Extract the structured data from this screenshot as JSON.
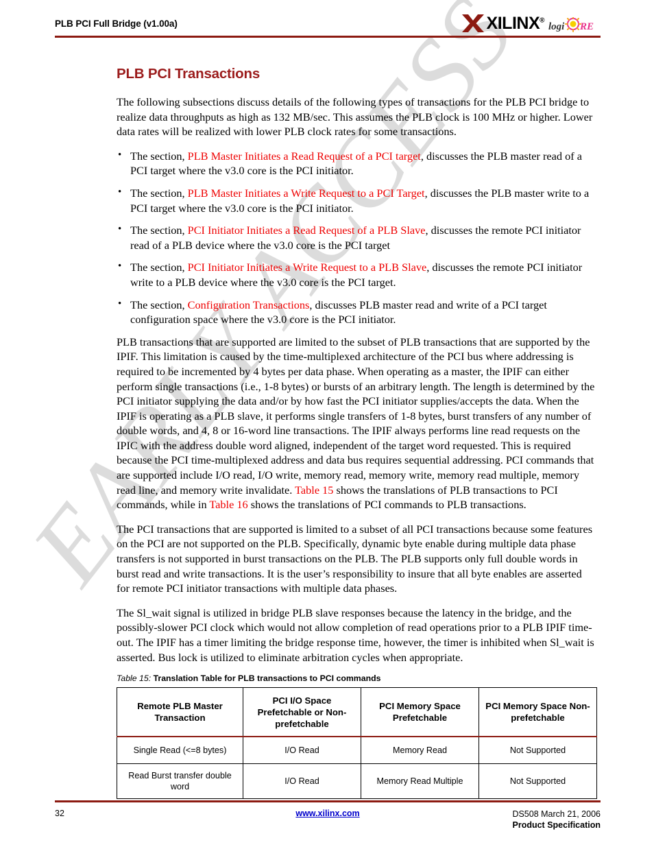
{
  "header": {
    "title": "PLB PCI Full Bridge (v1.00a)",
    "logo_wordmark": "XILINX",
    "logo_reg": "®",
    "logo_core": "logiCORE",
    "rule_color": "#8C1A11"
  },
  "watermark": {
    "text": "EARLY ACCESS",
    "color": "#dcdcdc"
  },
  "main": {
    "section_title": "PLB PCI Transactions",
    "title_color": "#9B1B1B",
    "xref_color": "#EE0000",
    "intro": "The following subsections discuss details of the following types of transactions for the PLB PCI bridge to realize data throughputs as high as 132 MB/sec. This assumes the PLB clock is 100 MHz or higher. Lower data rates will be realized with lower PLB clock rates for some transactions.",
    "bullets": [
      {
        "pre": "The section, ",
        "link": "PLB Master Initiates a Read Request of a PCI target",
        "post": ", discusses the PLB master read of a PCI target where the v3.0 core is the PCI initiator."
      },
      {
        "pre": "The section, ",
        "link": "PLB Master Initiates a Write Request to a PCI Target",
        "post": ", discusses the PLB master write to a PCI target where the v3.0 core is the PCI initiator."
      },
      {
        "pre": "The section, ",
        "link": "PCI Initiator Initiates a Read Request of a PLB Slave",
        "post": ", discusses the remote PCI initiator read of a PLB device where the v3.0 core is the PCI target"
      },
      {
        "pre": "The section, ",
        "link": "PCI Initiator Initiates a Write Request to a PLB Slave",
        "post": ", discusses the remote PCI initiator write to a PLB device where the v3.0 core is the PCI target."
      },
      {
        "pre": "The section, ",
        "link": "Configuration Transactions",
        "post": ", discusses PLB master read and write of a PCI target configuration space where the v3.0 core is the PCI initiator."
      }
    ],
    "para_plb_1": "PLB transactions that are supported are limited to the subset of PLB transactions that are supported by the IPIF. This limitation is caused by the time-multiplexed architecture of the PCI bus where addressing is required to be incremented by 4 bytes per data phase. When operating as a master, the IPIF can either perform single transactions (i.e., 1-8 bytes) or bursts of an arbitrary length. The length is determined by the PCI initiator supplying the data and/or by how fast the PCI initiator supplies/accepts the data. When the IPIF is operating as a PLB slave, it performs single transfers of 1-8 bytes, burst transfers of any number of double words, and 4, 8 or 16-word line transactions. The IPIF always performs line read requests on the IPIC with the address double word aligned, independent of the target word requested. This is required because the PCI time-multiplexed address and data bus requires sequential addressing. PCI commands that are supported include I/O read, I/O write, memory read, memory write, memory read multiple, memory read line, and memory write invalidate. ",
    "para_plb_xref_1": "Table 15",
    "para_plb_2": " shows the translations of PLB transactions to PCI commands, while in ",
    "para_plb_xref_2": "Table 16",
    "para_plb_3": " shows the translations of PCI commands to PLB transactions.",
    "para_pci": "The PCI transactions that are supported is limited to a subset of all PCI transactions because some features on the PCI are not supported on the PLB. Specifically, dynamic byte enable during multiple data phase transfers is not supported in burst transactions on the PLB. The PLB supports only full double words in burst read and write transactions. It is the user’s responsibility to insure that all byte enables are asserted for remote PCI initiator transactions with multiple data phases.",
    "para_slwait": "The Sl_wait signal is utilized in bridge PLB slave responses because the latency in the bridge, and the possibly-slower PCI clock which would not allow completion of read operations prior to a PLB IPIF time-out. The IPIF has a timer limiting the bridge response time, however, the timer is inhibited when Sl_wait is asserted. Bus lock is utilized to eliminate arbitration cycles when appropriate."
  },
  "table15": {
    "caption_label": "Table  15:",
    "caption_title": "Translation Table for PLB transactions to PCI commands",
    "headers": [
      "Remote PLB Master Transaction",
      "PCI I/O Space Prefetchable or Non-prefetchable",
      "PCI Memory Space Prefetchable",
      "PCI Memory Space Non-prefetchable"
    ],
    "rows": [
      [
        "Single Read (<=8 bytes)",
        "I/O Read",
        "Memory Read",
        "Not Supported"
      ],
      [
        "Read Burst transfer double word",
        "I/O Read",
        "Memory Read Multiple",
        "Not Supported"
      ]
    ]
  },
  "footer": {
    "page_number": "32",
    "link": "www.xilinx.com",
    "doc_id": "DS508 March 21, 2006",
    "spec": "Product Specification"
  }
}
